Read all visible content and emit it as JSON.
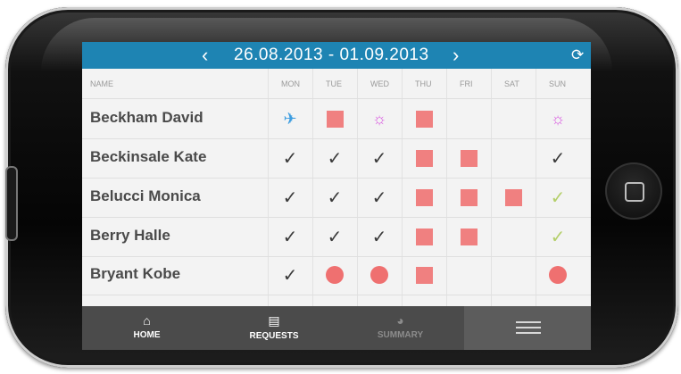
{
  "header": {
    "prev_arrow": "‹",
    "date_range": "26.08.2013 - 01.09.2013",
    "next_arrow": "›",
    "refresh_icon": "refresh-icon"
  },
  "columns": {
    "name": "NAME",
    "days": [
      "MON",
      "TUE",
      "WED",
      "THU",
      "FRI",
      "SAT",
      "SUN"
    ]
  },
  "legend_colors": {
    "header_bg": "#1e84b3",
    "absence_red": "#f08080",
    "travel_blue": "#3d9de0",
    "holiday_magenta": "#d95ae0",
    "weekend_check_green": "#b4cf6a"
  },
  "rows": [
    {
      "name": "Beckham David",
      "days": [
        "plane",
        "square",
        "sun",
        "square",
        "",
        "",
        "sun"
      ]
    },
    {
      "name": "Beckinsale Kate",
      "days": [
        "check",
        "check",
        "check",
        "square",
        "square",
        "",
        "check"
      ]
    },
    {
      "name": "Belucci Monica",
      "days": [
        "check",
        "check",
        "check",
        "square",
        "square",
        "square",
        "check-light"
      ]
    },
    {
      "name": "Berry Halle",
      "days": [
        "check",
        "check",
        "check",
        "square",
        "square",
        "",
        "check-light"
      ]
    },
    {
      "name": "Bryant Kobe",
      "days": [
        "check",
        "dot",
        "dot",
        "square",
        "",
        "",
        "dot"
      ]
    }
  ],
  "tabbar": {
    "home": {
      "label": "HOME",
      "icon": "home-icon"
    },
    "requests": {
      "label": "REQUESTS",
      "icon": "document-icon"
    },
    "summary": {
      "label": "SUMMARY",
      "icon": "pie-chart-icon"
    },
    "menu": {
      "icon": "menu-icon"
    }
  }
}
